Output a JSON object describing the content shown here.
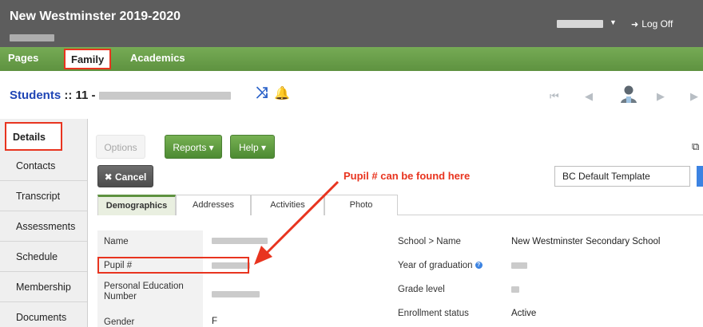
{
  "header": {
    "title": "New Westminster 2019-2020",
    "logoff": "Log Off"
  },
  "top_tabs": [
    {
      "label": "Pages"
    },
    {
      "label": "Family"
    },
    {
      "label": "Academics"
    }
  ],
  "title_row": {
    "students_link": "Students",
    "separator": " :: 11 -"
  },
  "side_nav": [
    {
      "label": "Details"
    },
    {
      "label": "Contacts"
    },
    {
      "label": "Transcript"
    },
    {
      "label": "Assessments"
    },
    {
      "label": "Schedule"
    },
    {
      "label": "Membership"
    },
    {
      "label": "Documents"
    }
  ],
  "toolbar": {
    "options": "Options",
    "reports": "Reports ▾",
    "help": "Help ▾",
    "cancel": "✖ Cancel"
  },
  "annotation": "Pupil # can be found here",
  "template_select": "BC Default Template",
  "subtabs": [
    "Demographics",
    "Addresses",
    "Activities",
    "Photo"
  ],
  "form": {
    "left": [
      {
        "label": "Name"
      },
      {
        "label": "Pupil #"
      },
      {
        "label": "Personal Education Number"
      },
      {
        "label": "Gender",
        "value": "F"
      }
    ],
    "right": [
      {
        "label": "School > Name",
        "value": "New Westminster Secondary School"
      },
      {
        "label": "Year of graduation"
      },
      {
        "label": "Grade level"
      },
      {
        "label": "Enrollment status",
        "value": "Active"
      }
    ]
  },
  "colors": {
    "header_bg": "#5d5d5d",
    "tab_green": "#6a9e4a",
    "highlight_red": "#e8341f",
    "link_blue": "#1f45b5"
  }
}
